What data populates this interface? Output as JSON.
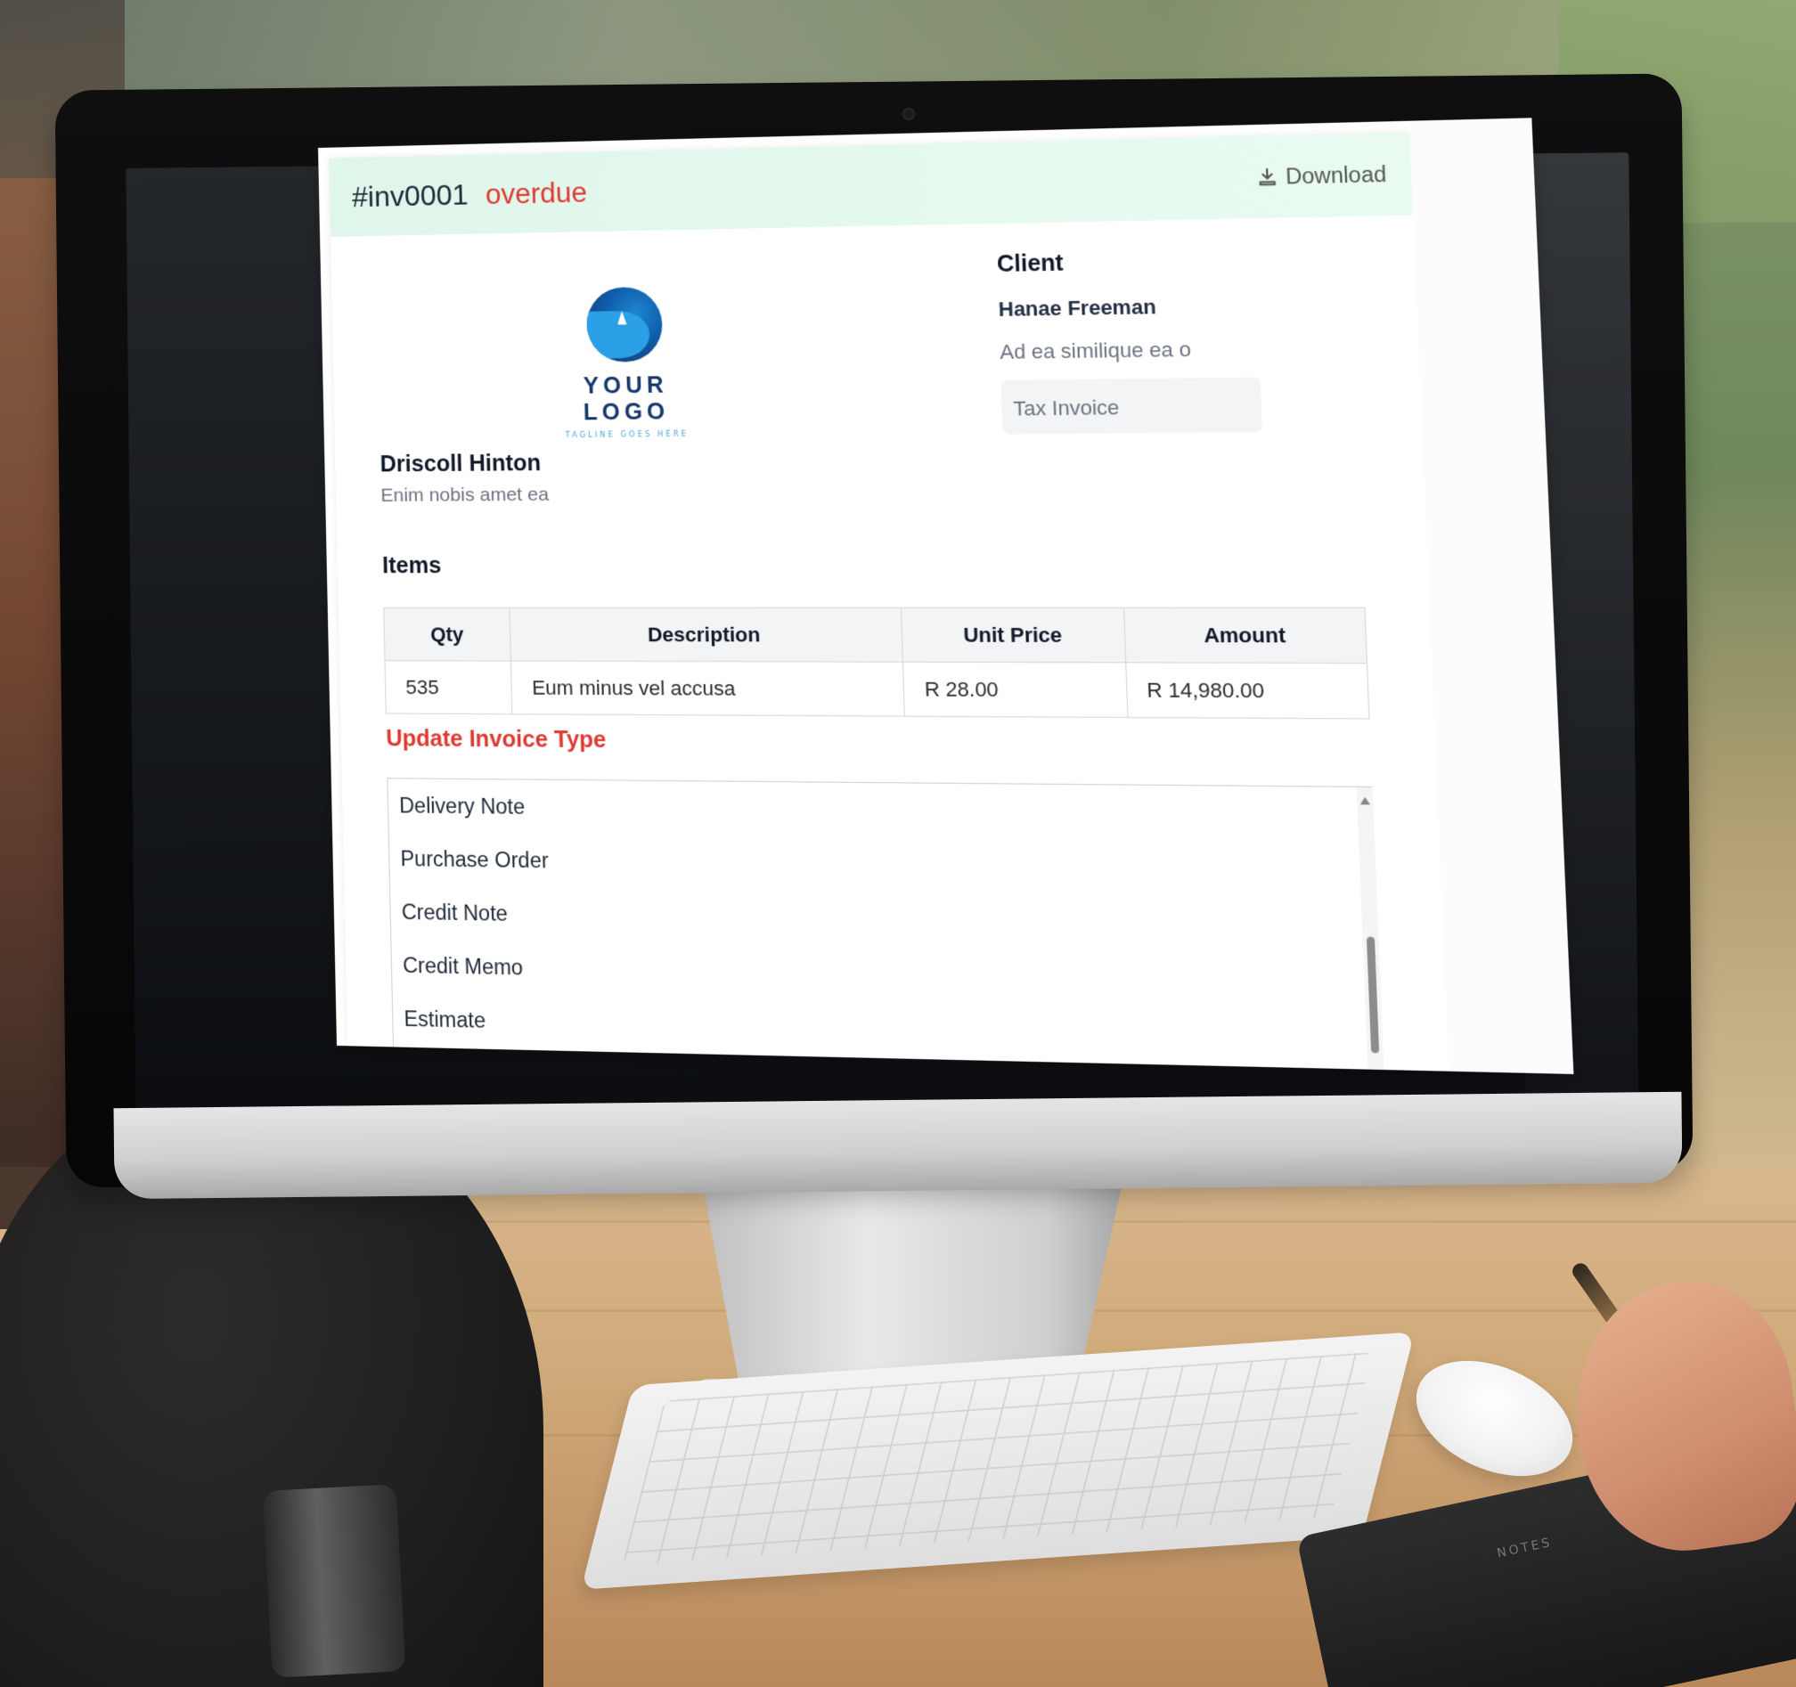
{
  "invoice": {
    "id": "#inv0001",
    "status": "overdue",
    "download_label": "Download"
  },
  "logo": {
    "text": "YOUR LOGO",
    "tagline": "TAGLINE GOES HERE"
  },
  "client": {
    "title": "Client",
    "name": "Hanae Freeman",
    "address": "Ad ea similique ea o",
    "invoice_type_placeholder": "Tax Invoice"
  },
  "from": {
    "name": "Driscoll Hinton",
    "subtitle": "Enim nobis amet ea"
  },
  "items": {
    "title": "Items",
    "columns": [
      "Qty",
      "Description",
      "Unit Price",
      "Amount"
    ],
    "rows": [
      {
        "qty": "535",
        "description": "Eum minus vel accusa",
        "unit_price": "R 28.00",
        "amount": "R 14,980.00"
      }
    ]
  },
  "update_invoice_type": {
    "title": "Update Invoice Type",
    "options": [
      "Delivery Note",
      "Purchase Order",
      "Credit Note",
      "Credit Memo",
      "Estimate"
    ]
  },
  "scene": {
    "notebook_label": "NOTES"
  }
}
